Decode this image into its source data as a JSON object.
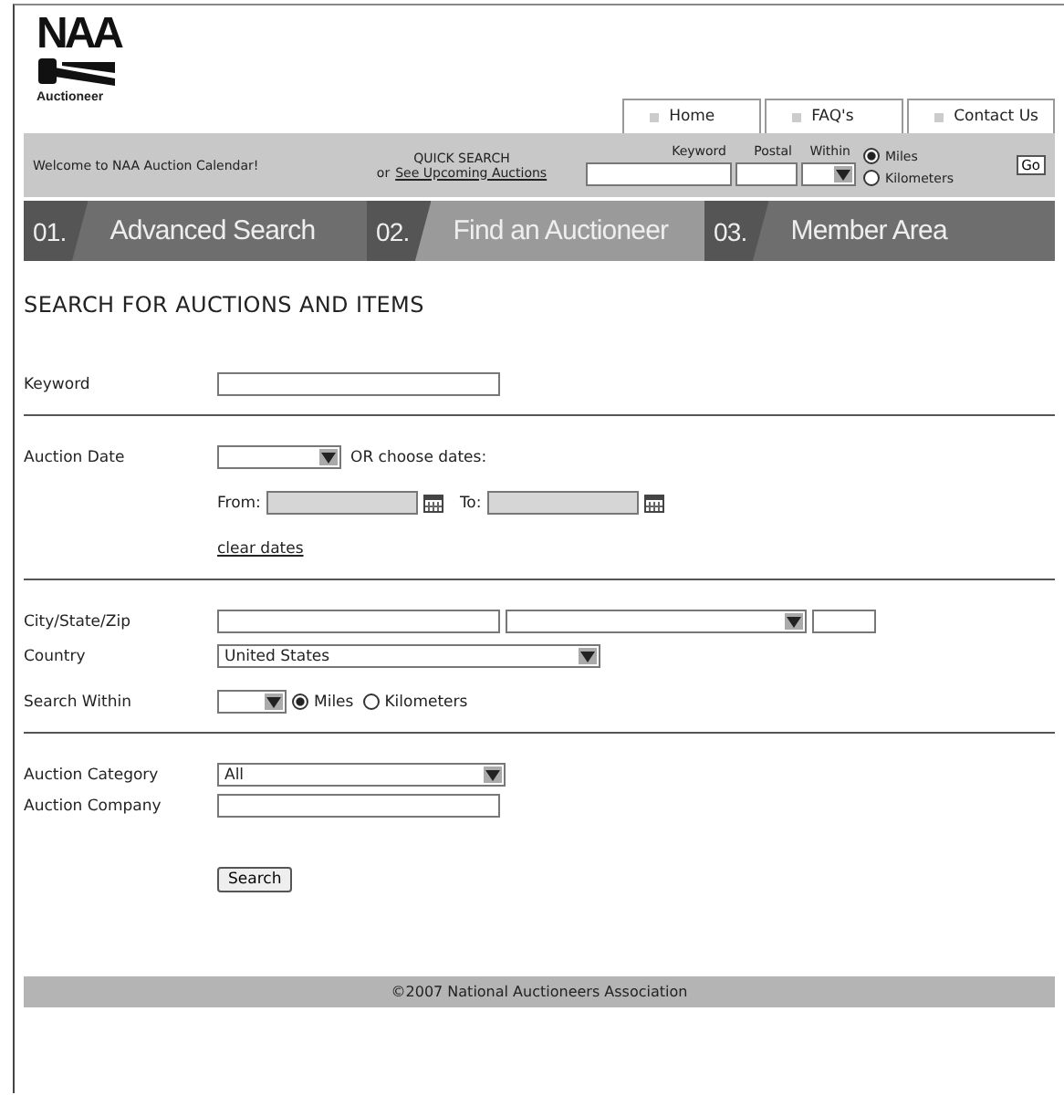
{
  "logo": {
    "title": "NAA",
    "subtitle": "Auctioneer"
  },
  "top_tabs": [
    {
      "label": "Home"
    },
    {
      "label": "FAQ's"
    },
    {
      "label": "Contact Us"
    }
  ],
  "quick_bar": {
    "welcome": "Welcome to NAA Auction Calendar!",
    "quick_search": "QUICK SEARCH",
    "or_text": "or",
    "link": "See Upcoming Auctions",
    "keyword_label": "Keyword",
    "postal_label": "Postal",
    "within_label": "Within",
    "units": [
      {
        "label": "Miles",
        "selected": true
      },
      {
        "label": "Kilometers",
        "selected": false
      }
    ],
    "go": "Go"
  },
  "nav": [
    {
      "number": "01.",
      "label": "Advanced Search",
      "selected": false
    },
    {
      "number": "02.",
      "label": "Find an Auctioneer",
      "selected": true
    },
    {
      "number": "03.",
      "label": "Member Area",
      "selected": false
    }
  ],
  "heading": "SEARCH FOR AUCTIONS AND ITEMS",
  "sections": [
    [
      {
        "kind": "text",
        "label": "Keyword"
      }
    ],
    [
      {
        "kind": "date_select",
        "label": "Auction Date",
        "or_text": "OR choose dates:"
      },
      {
        "kind": "date_range",
        "from": "From:",
        "to": "To:"
      },
      {
        "kind": "link",
        "text": "clear dates"
      }
    ],
    [
      {
        "kind": "city",
        "label": "City/State/Zip"
      },
      {
        "kind": "select",
        "label": "Country",
        "value": "United States"
      },
      {
        "kind": "within",
        "label": "Search Within",
        "units": [
          {
            "label": "Miles",
            "selected": true
          },
          {
            "label": "Kilometers",
            "selected": false
          }
        ]
      }
    ],
    [
      {
        "kind": "select",
        "label": "Auction Category",
        "value": "All"
      },
      {
        "kind": "text",
        "label": "Auction Company"
      }
    ]
  ],
  "search_button": "Search",
  "footer": "©2007 National Auctioneers Association"
}
